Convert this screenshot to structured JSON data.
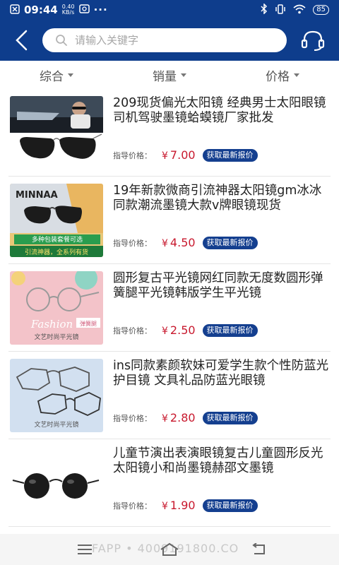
{
  "status_bar": {
    "time": "09:44",
    "speed_value": "0.40",
    "speed_unit": "KB/s",
    "dots": "···",
    "battery": "85"
  },
  "header": {
    "search_placeholder": "请输入关键字",
    "back_icon": "chevron-left-icon",
    "support_icon": "headset-icon"
  },
  "sort_bar": {
    "items": [
      {
        "label": "综合"
      },
      {
        "label": "销量"
      },
      {
        "label": "价格"
      }
    ]
  },
  "products": [
    {
      "title": "209现货偏光太阳镜 经典男士太阳眼镜司机驾驶墨镜蛤蟆镜厂家批发",
      "price_label": "指导价格：",
      "currency": "¥",
      "price": "7.00",
      "quote_label": "获取最新报价"
    },
    {
      "title": "19年新款微商引流神器太阳镜gm冰冰同款潮流墨镜大款v牌眼镜现货",
      "price_label": "指导价格：",
      "currency": "¥",
      "price": "4.50",
      "quote_label": "获取最新报价",
      "image_text": {
        "brand": "MINNAA",
        "line1": "多种包装套餐可选",
        "line2": "引流神器，全系列有货"
      }
    },
    {
      "title": "圆形复古平光镜网红同款无度数圆形弹簧腿平光镜韩版学生平光镜",
      "price_label": "指导价格：",
      "currency": "¥",
      "price": "2.50",
      "quote_label": "获取最新报价",
      "image_text": {
        "script": "Fashion",
        "badge": "弹簧腿",
        "caption": "文艺时尚平光镜"
      }
    },
    {
      "title": "ins同款素颜软妹可爱学生款个性防蓝光护目镜 文具礼品防蓝光眼镜",
      "price_label": "指导价格：",
      "currency": "¥",
      "price": "2.80",
      "quote_label": "获取最新报价",
      "image_text": {
        "caption": "文艺时尚平光镜"
      }
    },
    {
      "title": "儿童节演出表演眼镜复古儿童圆形反光太阳镜小和尚墨镜赫邵文墨镜",
      "price_label": "指导价格：",
      "currency": "¥",
      "price": "1.90",
      "quote_label": "获取最新报价"
    }
  ],
  "footer": {
    "text": "FAPP • 4009191800.CO"
  },
  "colors": {
    "brand_blue": "#0e3d8c",
    "price_red": "#c8192e",
    "quote_blue": "#143f8f"
  }
}
